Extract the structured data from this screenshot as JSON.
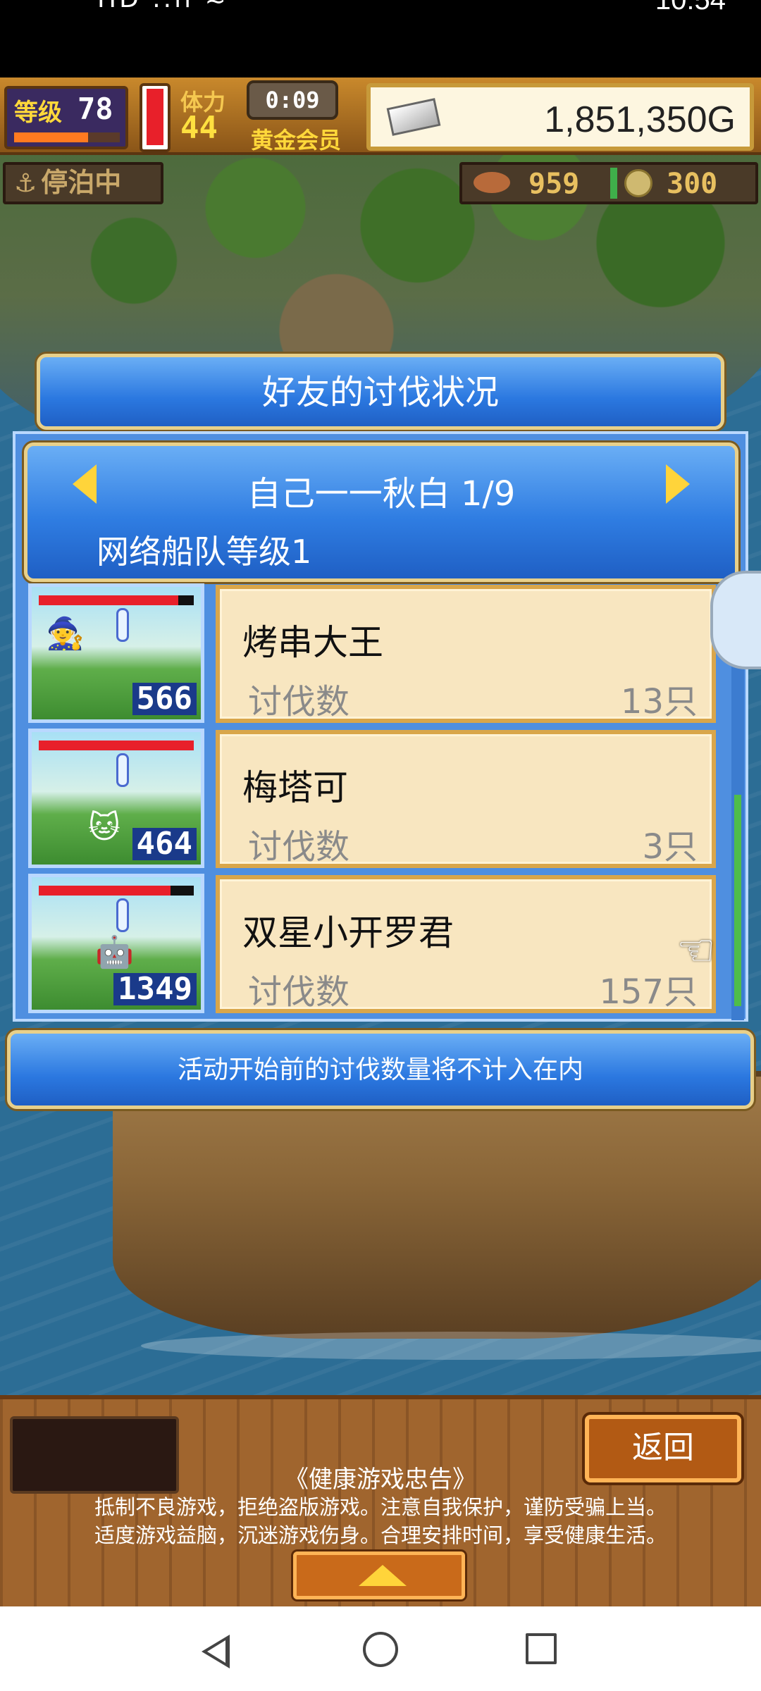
{
  "status_bar": {
    "left_indicators": "HD ..ıl ≈",
    "time": "10:54"
  },
  "hud": {
    "level_label": "等级",
    "level_value": "78",
    "level_progress": 0.7,
    "stamina_label": "体力",
    "stamina_value": "44",
    "stamina_level": 0.95,
    "timer": "0:09",
    "membership": "黄金会员",
    "gold": "1,851,350G",
    "moored_label": "停泊中",
    "fish_count": "959",
    "coin_count": "300"
  },
  "dialog": {
    "title": "好友的讨伐状况",
    "friend_name": "自己一一秋白 1/9",
    "fleet_level": "网络船队等级1",
    "rows": [
      {
        "name": "烤串大王",
        "kill_label": "讨伐数",
        "kill_value": "13只",
        "portrait_count": "566",
        "hp": 0.9,
        "monster_icon": "dark-wizard-icon"
      },
      {
        "name": "梅塔可",
        "kill_label": "讨伐数",
        "kill_value": "3只",
        "portrait_count": "464",
        "hp": 1.0,
        "monster_icon": "white-cat-icon"
      },
      {
        "name": "双星小开罗君",
        "kill_label": "讨伐数",
        "kill_value": "157只",
        "portrait_count": "1349",
        "hp": 0.85,
        "monster_icon": "yellow-robot-icon"
      }
    ],
    "notice": "活动开始前的讨伐数量将不计入在内"
  },
  "bottom": {
    "back_label": "返回",
    "health_title": "《健康游戏忠告》",
    "health_line1": "抵制不良游戏，拒绝盗版游戏。注意自我保护，谨防受骗上当。",
    "health_line2": "适度游戏益脑，沉迷游戏伤身。合理安排时间，享受健康生活。"
  },
  "colors": {
    "dialog_blue": "#2b78e0",
    "panel_cream": "#f8e6c0",
    "wood_brown": "#8a5526",
    "accent_yellow": "#ffd43a"
  }
}
